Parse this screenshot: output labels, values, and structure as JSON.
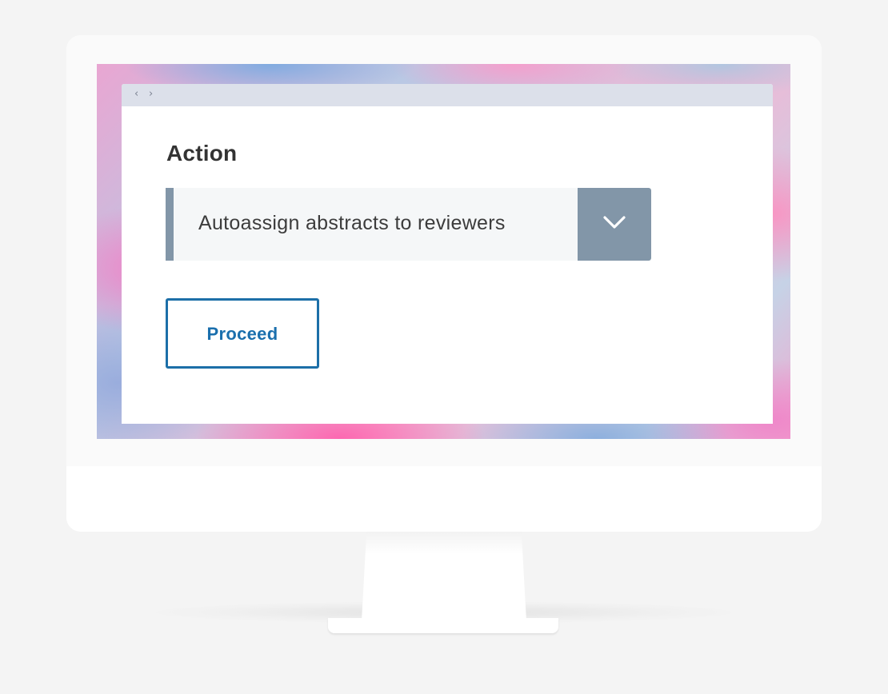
{
  "browser": {
    "back_icon": "‹",
    "forward_icon": "›"
  },
  "form": {
    "action_label": "Action",
    "action_select": {
      "selected_value": "Autoassign abstracts to reviewers",
      "toggle_icon": "chevron-down-icon"
    },
    "proceed_label": "Proceed"
  },
  "colors": {
    "accent": "#8296a8",
    "button_border": "#1c6fa8",
    "button_text": "#1a6fad",
    "browser_bar": "#dce0ea"
  }
}
